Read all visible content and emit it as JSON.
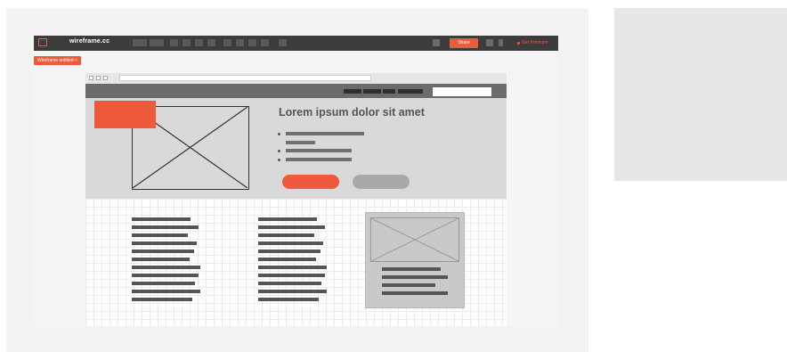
{
  "toolbar": {
    "brand": "wireframe.cc",
    "share_label": "Share",
    "right_link": "Get Premium"
  },
  "page_tab": {
    "label": "Wireframe untitled ×"
  },
  "hero": {
    "title": "Lorem ipsum dolor sit amet"
  },
  "footer": {
    "items": [
      "",
      "",
      "",
      ""
    ]
  },
  "colors": {
    "accent": "#f05a3c",
    "toolbar_bg": "#3c3c3c",
    "hero_bg": "#d9d9d9",
    "side_panel": "#e6e7e8"
  },
  "icons": {
    "logo": "wireframe-logo-icon",
    "image_placeholder": "image-placeholder-icon"
  }
}
